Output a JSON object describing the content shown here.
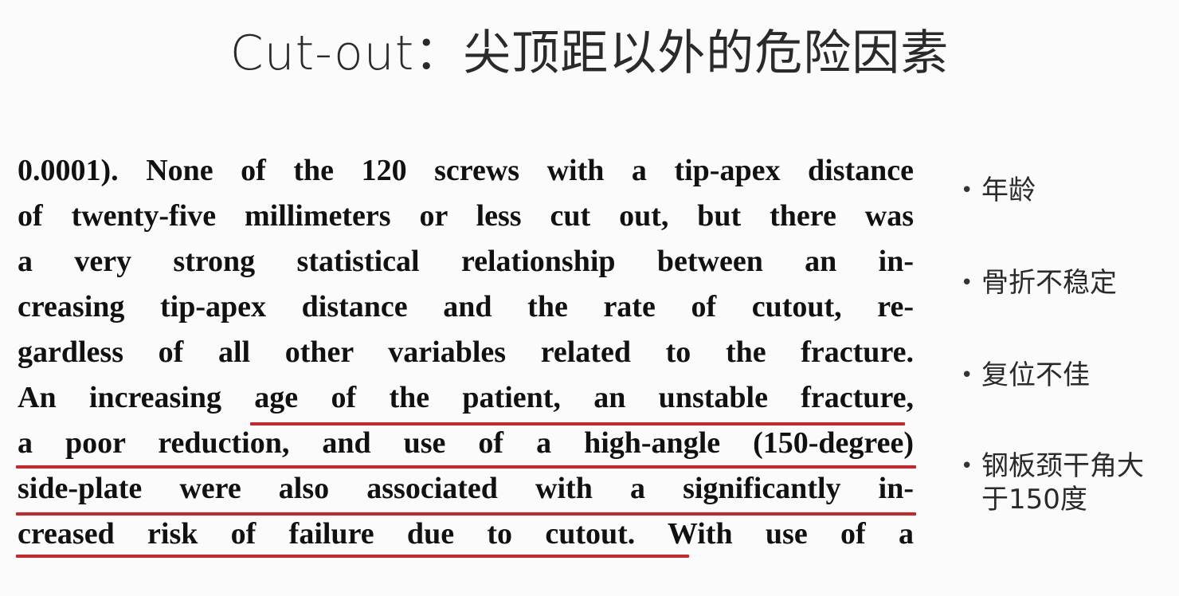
{
  "slide": {
    "title": "Cut-out：尖顶距以外的危险因素",
    "excerpt_lines": [
      "0.0001). None of the 120 screws with a tip-apex distance",
      "of twenty-five millimeters or less cut out, but there was",
      "a very strong statistical relationship between an in-",
      "creasing tip-apex distance and the rate of cutout, re-",
      "gardless of all other variables related to the fracture.",
      "An increasing age of the patient, an unstable fracture,",
      "a poor reduction, and use of a high-angle (150-degree)",
      "side-plate were also associated with a significantly in-",
      "creased risk of failure due to cutout. With use of a"
    ],
    "underline_color": "#c8262b",
    "bullet_glyph": "•",
    "bullets": [
      "年龄",
      "骨折不稳定",
      "复位不佳",
      "钢板颈干角大于150度"
    ]
  }
}
